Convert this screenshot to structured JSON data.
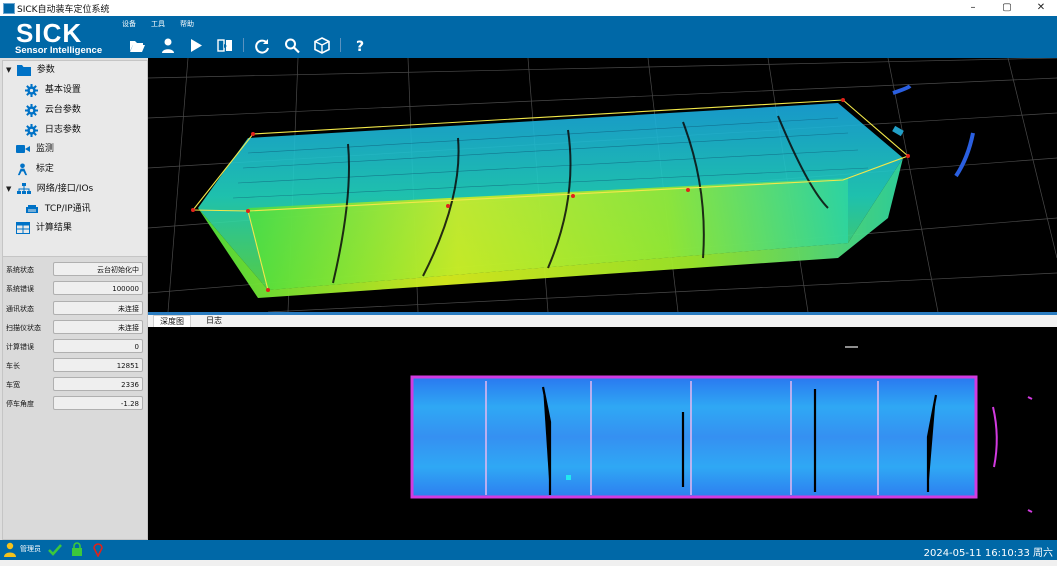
{
  "window": {
    "title": "SICK自动装车定位系统",
    "controls": {
      "minimize": "–",
      "maximize": "▢",
      "close": "✕"
    }
  },
  "logo": {
    "brand": "SICK",
    "tagline": "Sensor Intelligence"
  },
  "menu": {
    "items": [
      "设备",
      "工具",
      "帮助"
    ]
  },
  "toolbar": [
    "folder-open-icon",
    "user-icon",
    "play-icon",
    "book-icon",
    "refresh-icon",
    "search-icon",
    "box-icon",
    "help-icon"
  ],
  "tree": {
    "params": "参数",
    "basic_settings": "基本设置",
    "ptz_params": "云台参数",
    "log_params": "日志参数",
    "monitor": "监测",
    "calibrate": "标定",
    "network": "网络/接口/IOs",
    "tcpip": "TCP/IP通讯",
    "results": "计算结果"
  },
  "status": [
    {
      "label": "系统状态",
      "value": "云台初始化中"
    },
    {
      "label": "系统错误",
      "value": "100000"
    },
    {
      "label": "通讯状态",
      "value": "未连接"
    },
    {
      "label": "扫描仪状态",
      "value": "未连接"
    },
    {
      "label": "计算错误",
      "value": "0"
    },
    {
      "label": "车长",
      "value": "12851"
    },
    {
      "label": "车宽",
      "value": "2336"
    },
    {
      "label": "停车角度",
      "value": "-1.28"
    }
  ],
  "tabs": {
    "depth": "深度图",
    "log": "日志"
  },
  "footer": {
    "user": "管理员",
    "datetime": "2024-05-11 16:10:33 周六"
  },
  "colors": {
    "brand_blue": "#0068a7",
    "magenta_outline": "#d23be0",
    "cloud_yellow": "#e8f21a",
    "cloud_cyan": "#1ec8e8"
  }
}
